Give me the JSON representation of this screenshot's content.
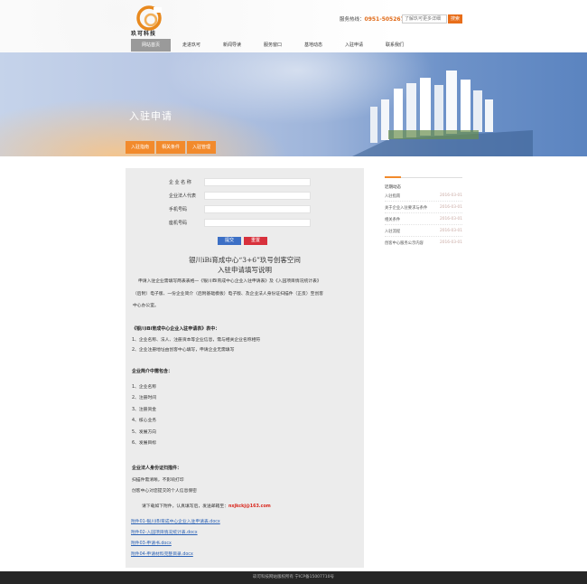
{
  "header": {
    "logo_text": "玖可科技",
    "hotline_label": "服务热线：",
    "hotline_number": "0951-5052677",
    "search_placeholder": "了解玖可更多详细",
    "search_button": "搜索"
  },
  "nav": {
    "items": [
      {
        "label": "网站首页"
      },
      {
        "label": "走进玖可"
      },
      {
        "label": "新闻导读"
      },
      {
        "label": "服务窗口"
      },
      {
        "label": "基地动态"
      },
      {
        "label": "入驻申请"
      },
      {
        "label": "联系我们"
      }
    ],
    "active_index": 0
  },
  "banner": {
    "title": "入驻申请"
  },
  "subtabs": [
    {
      "label": "入驻指南"
    },
    {
      "label": "相关条件"
    },
    {
      "label": "入驻管理"
    }
  ],
  "form": {
    "fields": [
      {
        "label": "企 业 名 称",
        "value": ""
      },
      {
        "label": "企业法人代表",
        "value": ""
      },
      {
        "label": "手机号码",
        "value": ""
      },
      {
        "label": "座机号码",
        "value": ""
      }
    ],
    "submit_label": "提交",
    "reset_label": "重置"
  },
  "doc": {
    "title_line1": "银川iBi育成中心“3+6”玖号创客空间",
    "title_line2": "入驻申请填写说明",
    "intro_line1": "申请入驻企业需填写两表表格—《银川iBi育成中心企业入驻申请表》及《入园项目情况统计表》",
    "intro_line2": "（后附）电子版、一份企业简介（后附基础模板）电子版、及企业法人身份证扫描件（正反）至创客",
    "intro_line3": "中心办公室。",
    "section1_title": "《银川iBi育成中心企业入驻申请表》表中：",
    "section1_items": [
      "1、企业名称、法人、注册资本等企业信息，需与相关企业名称相符",
      "2、企业注册地址由创客中心填写，申请企业无需填写"
    ],
    "section2_title": "企业简介中需包含：",
    "section2_items": [
      "1、企业名称",
      "2、注册时间",
      "3、注册资金",
      "4、核心业务",
      "5、发展方向",
      "6、发展目标"
    ],
    "section3_title": "企业法人身份证扫描件：",
    "section3_lines": [
      "扫描件需清晰，不影响打印",
      "创客中心对您提交的个人信息保密"
    ],
    "download_text": "请下载如下附件，认真填写后，发送邮箱至：",
    "email": "nxjkckj@163.com",
    "attachments": [
      "附件01-银川iBi育成中心企业入驻申请表.docx",
      "附件02-入园项目情况统计表.docx",
      "附件03-申请书.docx",
      "附件04-申请材料完整目录.docx"
    ]
  },
  "sidebar": {
    "heading": "近期动态",
    "items": [
      {
        "title": "入驻指南",
        "date": "2016-03-01"
      },
      {
        "title": "关于企业入驻要求与条件",
        "date": "2016-03-01"
      },
      {
        "title": "相关条件",
        "date": "2016-03-01"
      },
      {
        "title": "入驻流程",
        "date": "2016-03-01"
      },
      {
        "title": "创客中心服务公示内容",
        "date": "2016-03-01"
      }
    ]
  },
  "footer": {
    "text": "玖可科技网站版权所有   宁ICP备15007710号"
  },
  "colors": {
    "accent": "#f28a2c",
    "submit": "#3c6fc5",
    "reset": "#d8313c",
    "link": "#2c62b5",
    "footer_bg": "#262626"
  }
}
